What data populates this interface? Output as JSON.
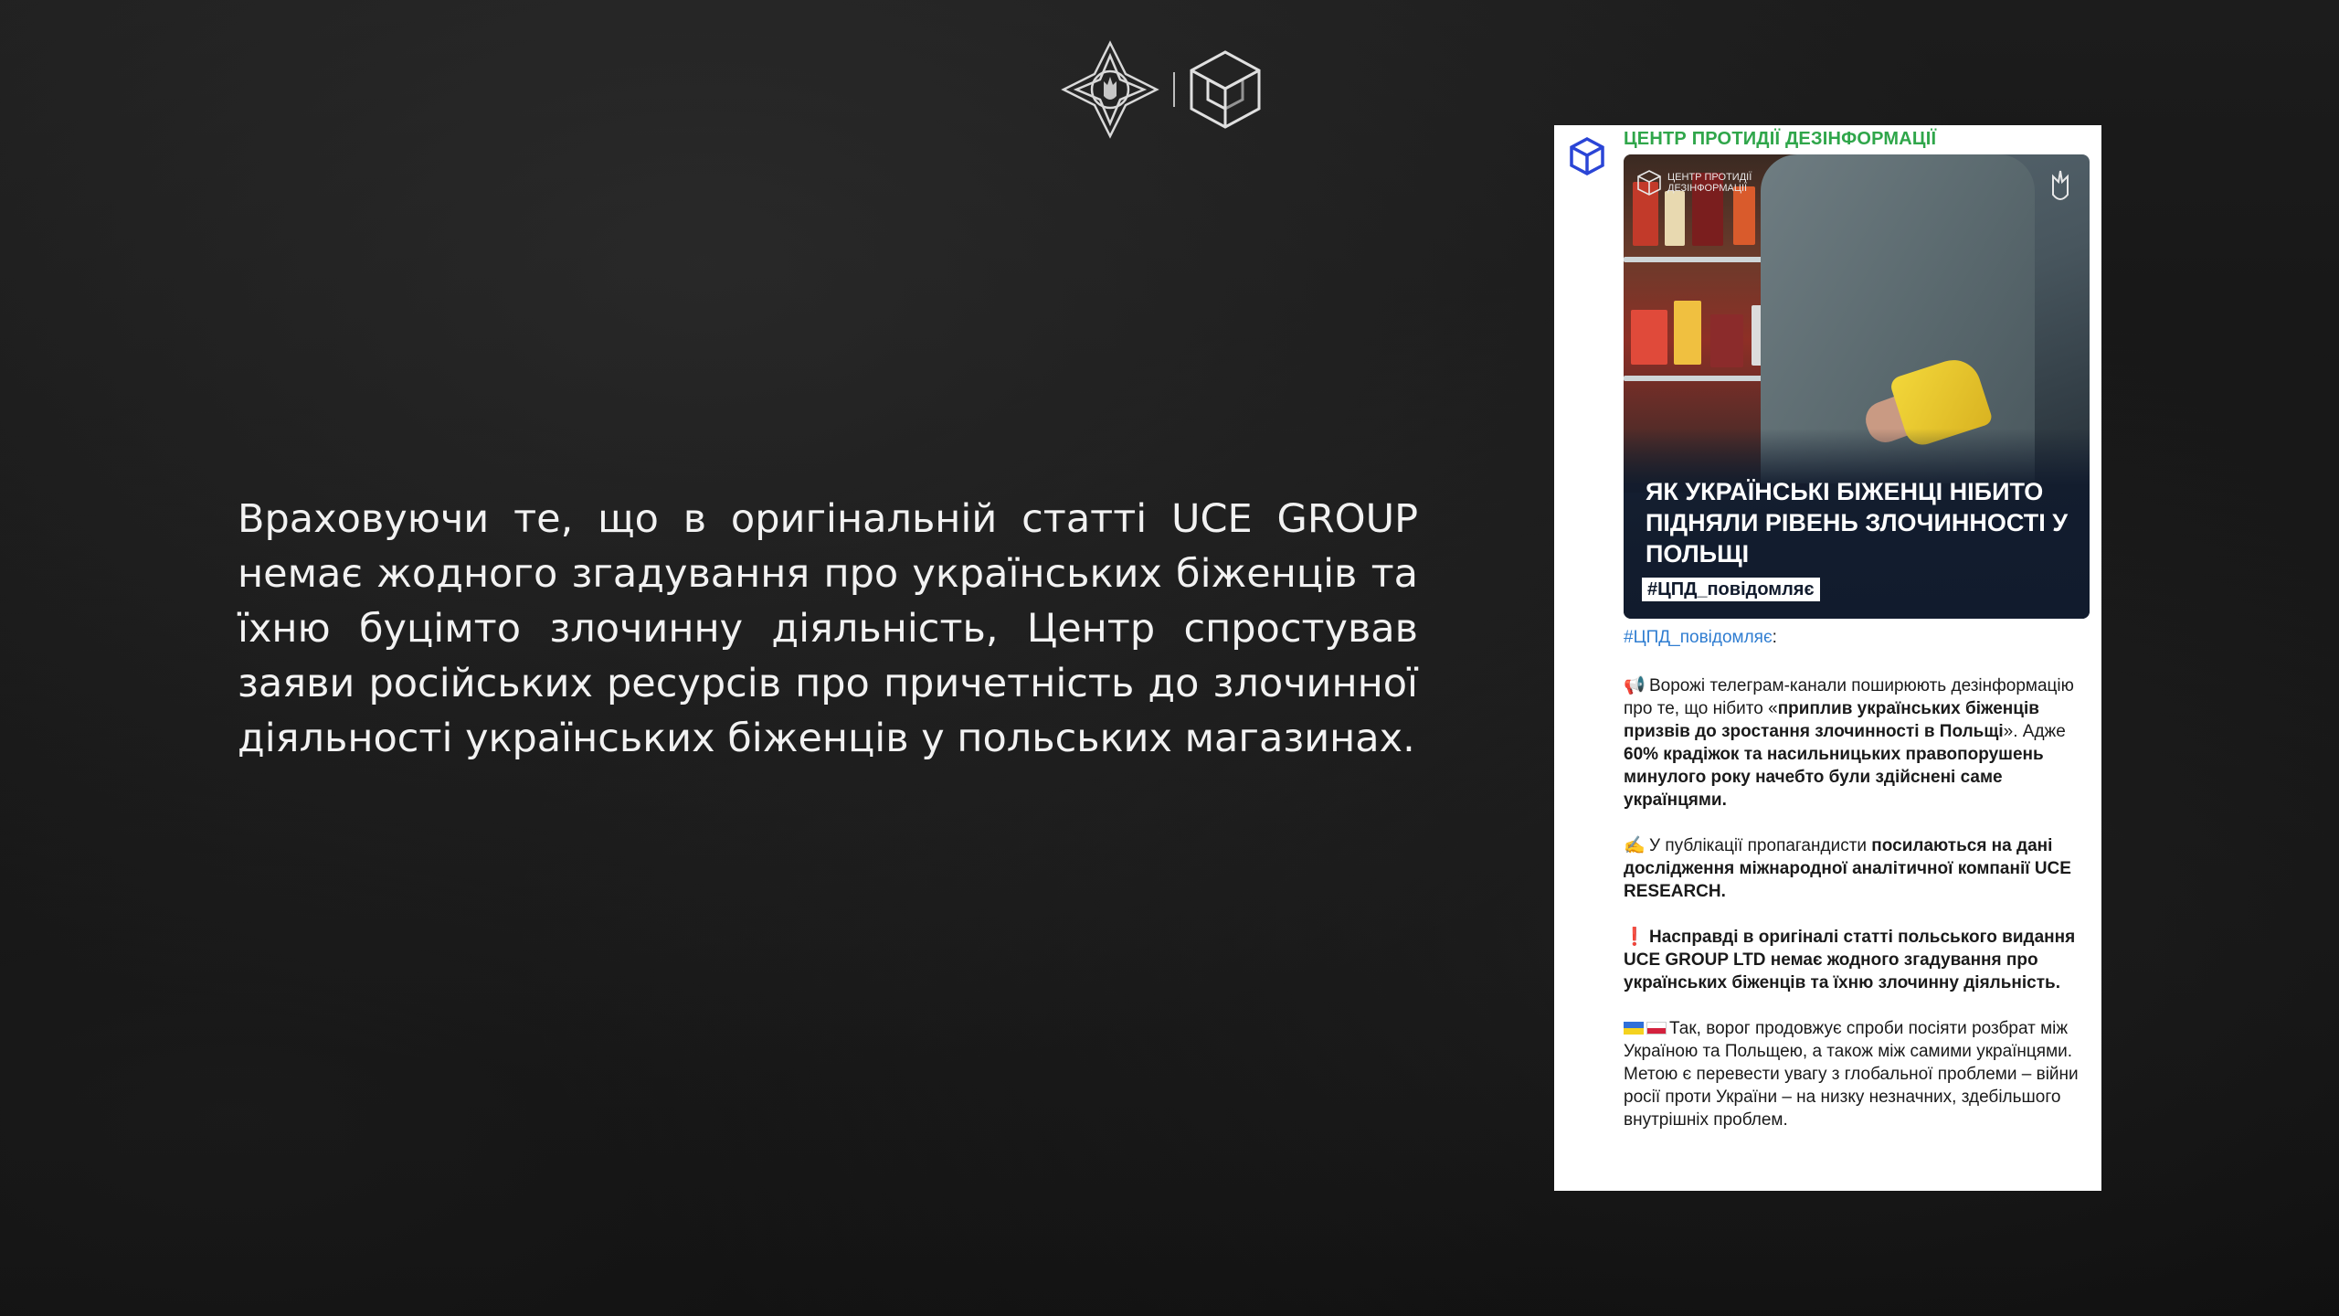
{
  "slide": {
    "main_text": "Враховуючи те, що в оригінальній статті UCE GROUP немає жодного згадування про українських біженців та їхню буцімто злочинну діяльність, Центр спростував заяви російських ресурсів про причетність до злочинної діяльності українських біженців у польських магазинах."
  },
  "logos": {
    "left_icon": "nsdc-emblem-icon",
    "right_icon": "cpd-cube-logo-icon"
  },
  "post": {
    "channel_name": "ЦЕНТР ПРОТИДІЇ ДЕЗІНФОРМАЦІЇ",
    "image": {
      "logo_text": "ЦЕНТР ПРОТИДІЇ ДЕЗІНФОРМАЦІЇ",
      "headline": "ЯК УКРАЇНСЬКІ БІЖЕНЦІ НІБИТО ПІДНЯЛИ РІВЕНЬ ЗЛОЧИННОСТІ У ПОЛЬЩІ",
      "tag": "#ЦПД_повідомляє"
    },
    "hashtag": "#ЦПД_повідомляє",
    "hashtag_suffix": ":",
    "p1_emoji": "📢",
    "p1_text_a": "Ворожі телеграм-канали поширюють дезінформацію про те, що нібито «",
    "p1_bold": "приплив українських біженців призвів до зростання злочинності в Польщі",
    "p1_text_b": "». Адже ",
    "p1_bold_2": "60% крадіжок та насильницьких правопорушень минулого року начебто були здійснені саме українцями.",
    "p2_emoji": "✍️",
    "p2_text_a": "У публікації пропагандисти ",
    "p2_bold": "посилаються на дані дослідження міжнародної аналітичної компанії UCE RESEARCH.",
    "p3_emoji": "❗",
    "p3_bold": "Насправді в оригіналі статті польського видання UCE GROUP LTD немає жодного згадування про українських біженців та їхню злочинну діяльність.",
    "p4_text": "Так, ворог продовжує спроби посіяти розбрат між Україною та Польщею, а також між самими українцями. Метою є перевести увагу з глобальної проблеми – війни росії проти України – на низку незначних, здебільшого внутрішніх проблем."
  }
}
